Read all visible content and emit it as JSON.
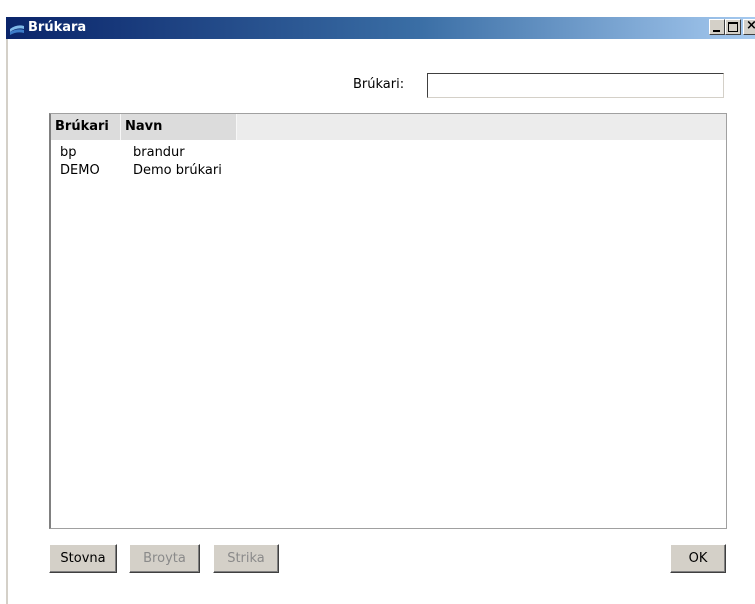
{
  "window": {
    "title": "Brúkara"
  },
  "search": {
    "label": "Brúkari:",
    "value": "",
    "placeholder": ""
  },
  "table": {
    "columns": [
      "Brúkari",
      "Navn"
    ],
    "rows": [
      [
        "bp",
        "brandur"
      ],
      [
        "DEMO",
        "Demo brúkari"
      ]
    ]
  },
  "buttons": {
    "save": "Stovna",
    "edit": "Broyta",
    "delete": "Strika",
    "ok": "OK"
  },
  "colors": {
    "titlebar_start": "#0a246a",
    "titlebar_end": "#a6caf0"
  }
}
